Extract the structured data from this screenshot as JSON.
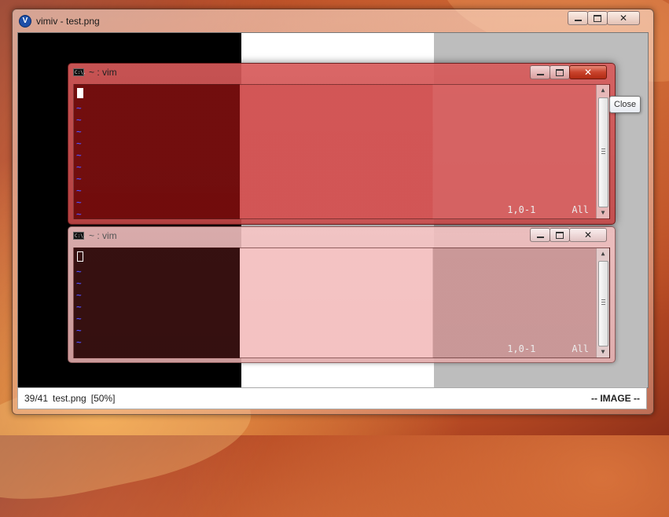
{
  "main_window": {
    "title": "vimiv - test.png",
    "logo_letter": "V"
  },
  "console_top": {
    "title": "~ : vim",
    "position": "1,0-1",
    "scroll": "All",
    "tildes": [
      "~",
      "~",
      "~",
      "~",
      "~",
      "~",
      "~",
      "~",
      "~",
      "~"
    ]
  },
  "console_bottom": {
    "title": "~ : vim",
    "position": "1,0-1",
    "scroll": "All",
    "tildes": [
      "~",
      "~",
      "~",
      "~",
      "~",
      "~",
      "~"
    ]
  },
  "cmd_icon_text": "C:\\.",
  "tooltip": "Close",
  "statusbar": {
    "index": "39/41",
    "filename": "test.png",
    "zoom": "[50%]",
    "mode": "-- IMAGE --"
  },
  "icons": {
    "minimize": "minimize-icon",
    "maximize": "maximize-icon",
    "close": "close-icon"
  }
}
